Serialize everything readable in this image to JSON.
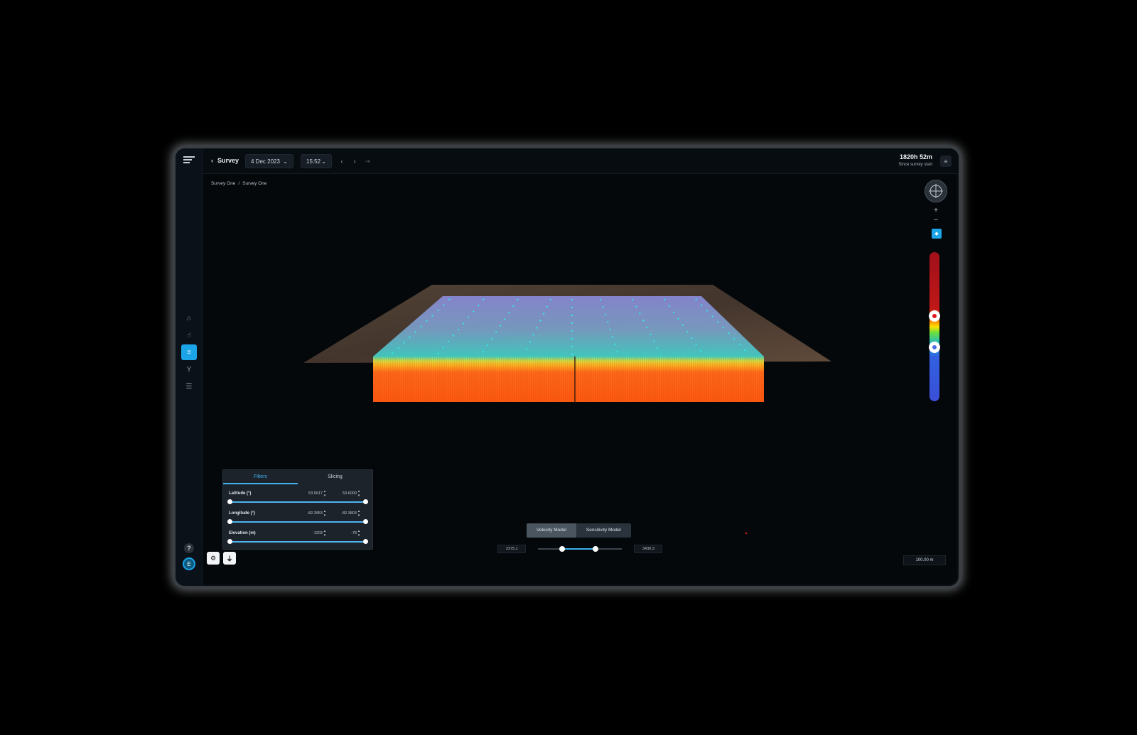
{
  "header": {
    "back_label": "Survey",
    "date": "4 Dec 2023",
    "time": "15:52",
    "elapsed": "1820h 52m",
    "elapsed_caption": "Since survey start"
  },
  "breadcrumb": [
    "Survey One",
    "Survey One"
  ],
  "sidebar": {
    "items": [
      {
        "icon": "home-icon"
      },
      {
        "icon": "pointer-icon"
      },
      {
        "icon": "layers-icon",
        "active": true
      },
      {
        "icon": "antenna-icon"
      },
      {
        "icon": "database-icon"
      }
    ],
    "help_label": "?",
    "avatar_initial": "E"
  },
  "filters_panel": {
    "tabs": [
      "Filters",
      "Slicing"
    ],
    "active_tab": "Filters",
    "rows": [
      {
        "label": "Latitude (°)",
        "min": "53.5617",
        "max": "53.6000"
      },
      {
        "label": "Longitude (°)",
        "min": "-82.3953",
        "max": "-82.3803"
      },
      {
        "label": "Elevation (m)",
        "min": "-1203",
        "max": "-78"
      }
    ]
  },
  "model_toggle": {
    "options": [
      "Velocity Model",
      "Sensitivity Model"
    ],
    "active": "Velocity Model"
  },
  "velocity_range": {
    "min": "2375.1",
    "max": "3430.3",
    "low_fraction": 0.29,
    "high_fraction": 0.69
  },
  "zoom": {
    "plus": "+",
    "minus": "−"
  },
  "scale_bar": "100.00 m",
  "colorbar": {
    "top_handle_fraction": 0.43,
    "bottom_handle_fraction": 0.64
  },
  "colors": {
    "accent": "#1ba4e8",
    "panel": "#1c232b"
  }
}
